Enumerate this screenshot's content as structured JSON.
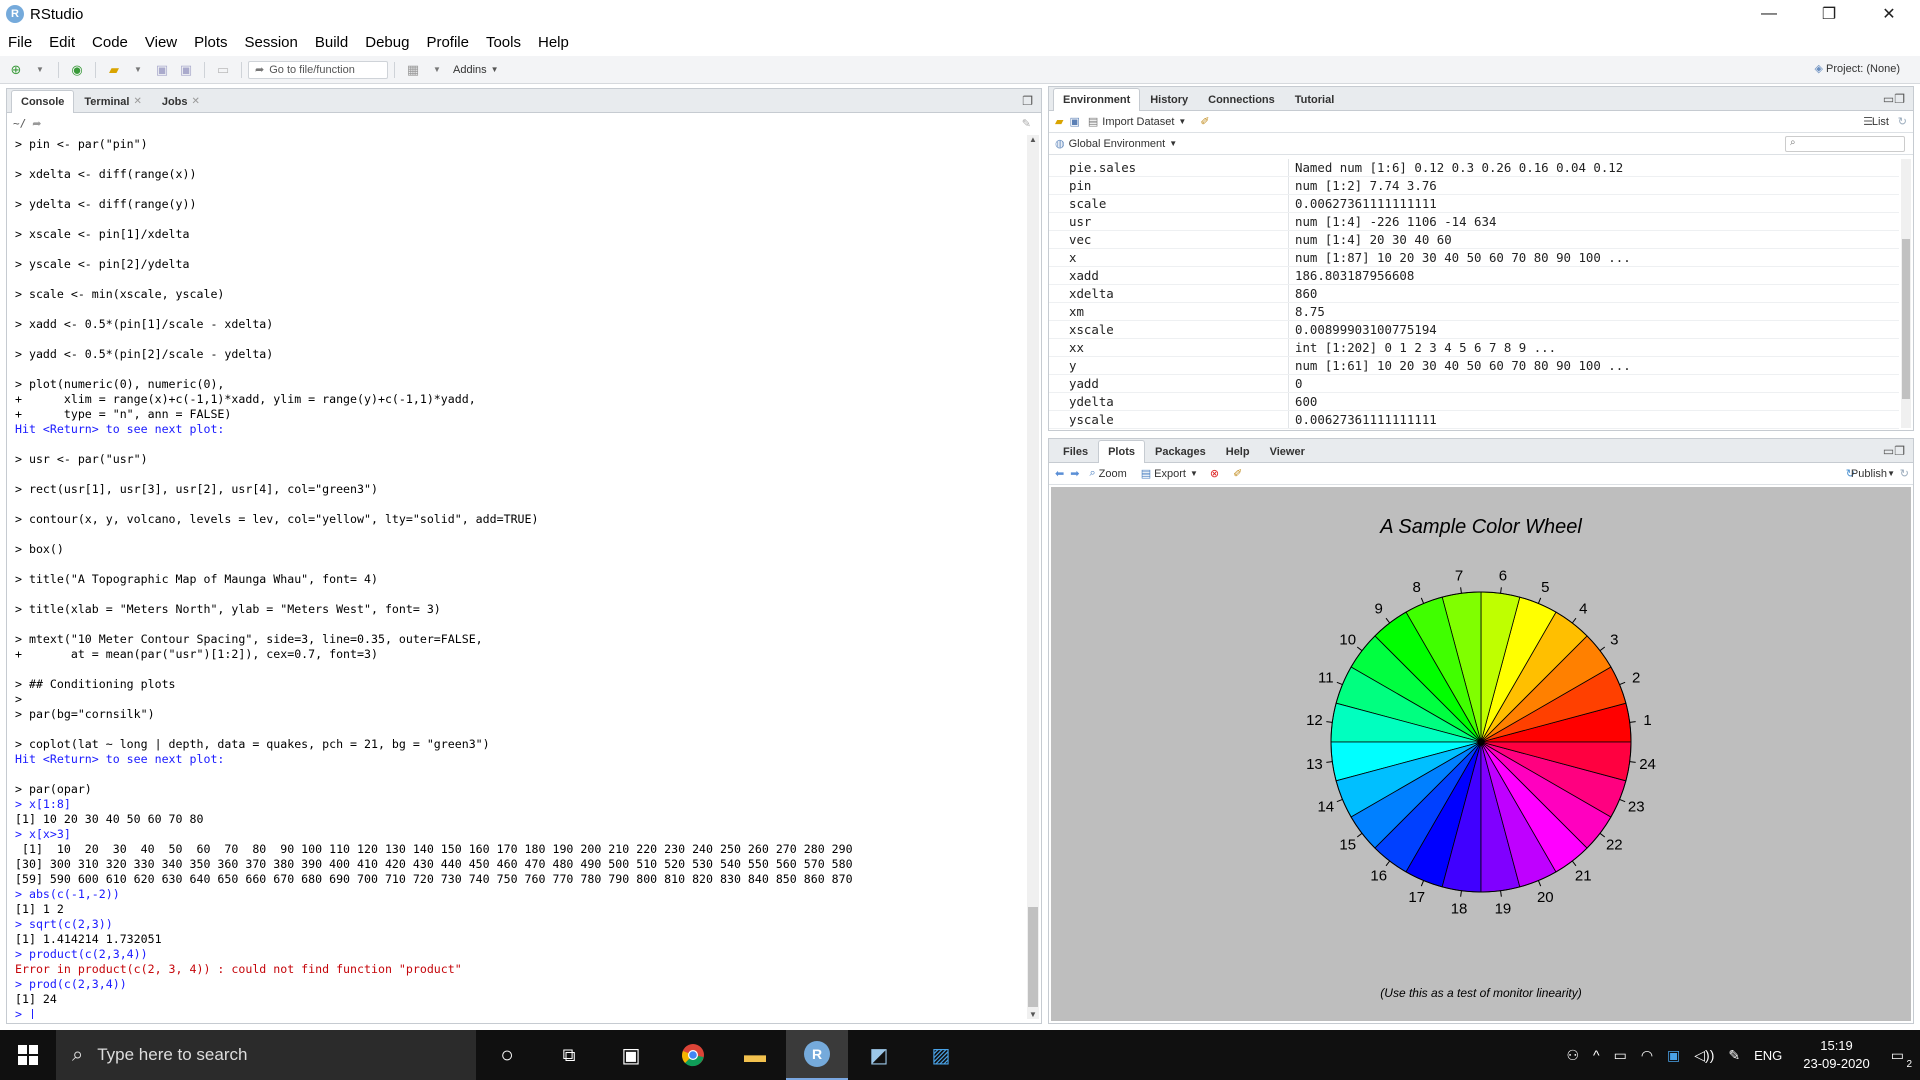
{
  "window": {
    "title": "RStudio",
    "logo": "R",
    "minimize_glyph": "—",
    "maximize_glyph": "❐",
    "close_glyph": "✕"
  },
  "menu": [
    "File",
    "Edit",
    "Code",
    "View",
    "Plots",
    "Session",
    "Build",
    "Debug",
    "Profile",
    "Tools",
    "Help"
  ],
  "toolbar": {
    "goto_placeholder": "Go to file/function",
    "addins_label": "Addins",
    "project_label": "Project: (None)"
  },
  "console": {
    "tabs": [
      {
        "label": "Console",
        "closable": false
      },
      {
        "label": "Terminal",
        "closable": true
      },
      {
        "label": "Jobs",
        "closable": true
      }
    ],
    "path": "~/",
    "lines": [
      {
        "t": "> pin <- par(\"pin\")",
        "k": "cmd"
      },
      {
        "t": "",
        "k": "gap"
      },
      {
        "t": "> xdelta <- diff(range(x))",
        "k": "cmd"
      },
      {
        "t": "",
        "k": "gap"
      },
      {
        "t": "> ydelta <- diff(range(y))",
        "k": "cmd"
      },
      {
        "t": "",
        "k": "gap"
      },
      {
        "t": "> xscale <- pin[1]/xdelta",
        "k": "cmd"
      },
      {
        "t": "",
        "k": "gap"
      },
      {
        "t": "> yscale <- pin[2]/ydelta",
        "k": "cmd"
      },
      {
        "t": "",
        "k": "gap"
      },
      {
        "t": "> scale <- min(xscale, yscale)",
        "k": "cmd"
      },
      {
        "t": "",
        "k": "gap"
      },
      {
        "t": "> xadd <- 0.5*(pin[1]/scale - xdelta)",
        "k": "cmd"
      },
      {
        "t": "",
        "k": "gap"
      },
      {
        "t": "> yadd <- 0.5*(pin[2]/scale - ydelta)",
        "k": "cmd"
      },
      {
        "t": "",
        "k": "gap"
      },
      {
        "t": "> plot(numeric(0), numeric(0),",
        "k": "cmd"
      },
      {
        "t": "+      xlim = range(x)+c(-1,1)*xadd, ylim = range(y)+c(-1,1)*yadd,",
        "k": "cmd"
      },
      {
        "t": "+      type = \"n\", ann = FALSE)",
        "k": "cmd"
      },
      {
        "t": "Hit <Return> to see next plot:",
        "k": "blue"
      },
      {
        "t": "",
        "k": "gap"
      },
      {
        "t": "> usr <- par(\"usr\")",
        "k": "cmd"
      },
      {
        "t": "",
        "k": "gap"
      },
      {
        "t": "> rect(usr[1], usr[3], usr[2], usr[4], col=\"green3\")",
        "k": "cmd"
      },
      {
        "t": "",
        "k": "gap"
      },
      {
        "t": "> contour(x, y, volcano, levels = lev, col=\"yellow\", lty=\"solid\", add=TRUE)",
        "k": "cmd"
      },
      {
        "t": "",
        "k": "gap"
      },
      {
        "t": "> box()",
        "k": "cmd"
      },
      {
        "t": "",
        "k": "gap"
      },
      {
        "t": "> title(\"A Topographic Map of Maunga Whau\", font= 4)",
        "k": "cmd"
      },
      {
        "t": "",
        "k": "gap"
      },
      {
        "t": "> title(xlab = \"Meters North\", ylab = \"Meters West\", font= 3)",
        "k": "cmd"
      },
      {
        "t": "",
        "k": "gap"
      },
      {
        "t": "> mtext(\"10 Meter Contour Spacing\", side=3, line=0.35, outer=FALSE,",
        "k": "cmd"
      },
      {
        "t": "+       at = mean(par(\"usr\")[1:2]), cex=0.7, font=3)",
        "k": "cmd"
      },
      {
        "t": "",
        "k": "gap"
      },
      {
        "t": "> ## Conditioning plots",
        "k": "cmd"
      },
      {
        "t": ">",
        "k": "cmd"
      },
      {
        "t": "> par(bg=\"cornsilk\")",
        "k": "cmd"
      },
      {
        "t": "",
        "k": "gap"
      },
      {
        "t": "> coplot(lat ~ long | depth, data = quakes, pch = 21, bg = \"green3\")",
        "k": "cmd"
      },
      {
        "t": "Hit <Return> to see next plot:",
        "k": "blue"
      },
      {
        "t": "",
        "k": "gap"
      },
      {
        "t": "> par(opar)",
        "k": "cmd"
      },
      {
        "t": "> x[1:8]",
        "k": "blue"
      },
      {
        "t": "[1] 10 20 30 40 50 60 70 80",
        "k": "out"
      },
      {
        "t": "> x[x>3]",
        "k": "blue"
      },
      {
        "t": " [1]  10  20  30  40  50  60  70  80  90 100 110 120 130 140 150 160 170 180 190 200 210 220 230 240 250 260 270 280 290",
        "k": "out"
      },
      {
        "t": "[30] 300 310 320 330 340 350 360 370 380 390 400 410 420 430 440 450 460 470 480 490 500 510 520 530 540 550 560 570 580",
        "k": "out"
      },
      {
        "t": "[59] 590 600 610 620 630 640 650 660 670 680 690 700 710 720 730 740 750 760 770 780 790 800 810 820 830 840 850 860 870",
        "k": "out"
      },
      {
        "t": "> abs(c(-1,-2))",
        "k": "blue"
      },
      {
        "t": "[1] 1 2",
        "k": "out"
      },
      {
        "t": "> sqrt(c(2,3))",
        "k": "blue"
      },
      {
        "t": "[1] 1.414214 1.732051",
        "k": "out"
      },
      {
        "t": "> product(c(2,3,4))",
        "k": "blue"
      },
      {
        "t": "Error in product(c(2, 3, 4)) : could not find function \"product\"",
        "k": "err"
      },
      {
        "t": "> prod(c(2,3,4))",
        "k": "blue"
      },
      {
        "t": "[1] 24",
        "k": "out"
      },
      {
        "t": "> |",
        "k": "blue"
      }
    ]
  },
  "environment": {
    "tabs": [
      "Environment",
      "History",
      "Connections",
      "Tutorial"
    ],
    "import_label": "Import Dataset",
    "list_label": "List",
    "scope_label": "Global Environment",
    "rows": [
      {
        "name": "pie.sales",
        "value": "Named num [1:6] 0.12 0.3 0.26 0.16 0.04 0.12"
      },
      {
        "name": "pin",
        "value": "num [1:2] 7.74 3.76"
      },
      {
        "name": "scale",
        "value": "0.00627361111111111"
      },
      {
        "name": "usr",
        "value": "num [1:4] -226 1106 -14 634"
      },
      {
        "name": "vec",
        "value": "num [1:4] 20 30 40 60"
      },
      {
        "name": "x",
        "value": "num [1:87] 10 20 30 40 50 60 70 80 90 100 ..."
      },
      {
        "name": "xadd",
        "value": "186.803187956608"
      },
      {
        "name": "xdelta",
        "value": "860"
      },
      {
        "name": "xm",
        "value": "8.75"
      },
      {
        "name": "xscale",
        "value": "0.00899903100775194"
      },
      {
        "name": "xx",
        "value": "int [1:202] 0 1 2 3 4 5 6 7 8 9 ..."
      },
      {
        "name": "y",
        "value": "num [1:61] 10 20 30 40 50 60 70 80 90 100 ..."
      },
      {
        "name": "yadd",
        "value": "0"
      },
      {
        "name": "ydelta",
        "value": "600"
      },
      {
        "name": "yscale",
        "value": "0.00627361111111111"
      }
    ]
  },
  "plots_pane": {
    "tabs": [
      "Files",
      "Plots",
      "Packages",
      "Help",
      "Viewer"
    ],
    "zoom_label": "Zoom",
    "export_label": "Export",
    "publish_label": "Publish",
    "plot_title": "A Sample Color Wheel",
    "plot_caption": "(Use this as a test of monitor linearity)",
    "wheel_labels": [
      "1",
      "2",
      "3",
      "4",
      "5",
      "6",
      "7",
      "8",
      "9",
      "10",
      "11",
      "12",
      "13",
      "14",
      "15",
      "16",
      "17",
      "18",
      "19",
      "20",
      "21",
      "22",
      "23",
      "24"
    ]
  },
  "taskbar": {
    "search_placeholder": "Type here to search",
    "language": "ENG",
    "time": "15:19",
    "date": "23-09-2020",
    "notification_count": "2"
  }
}
